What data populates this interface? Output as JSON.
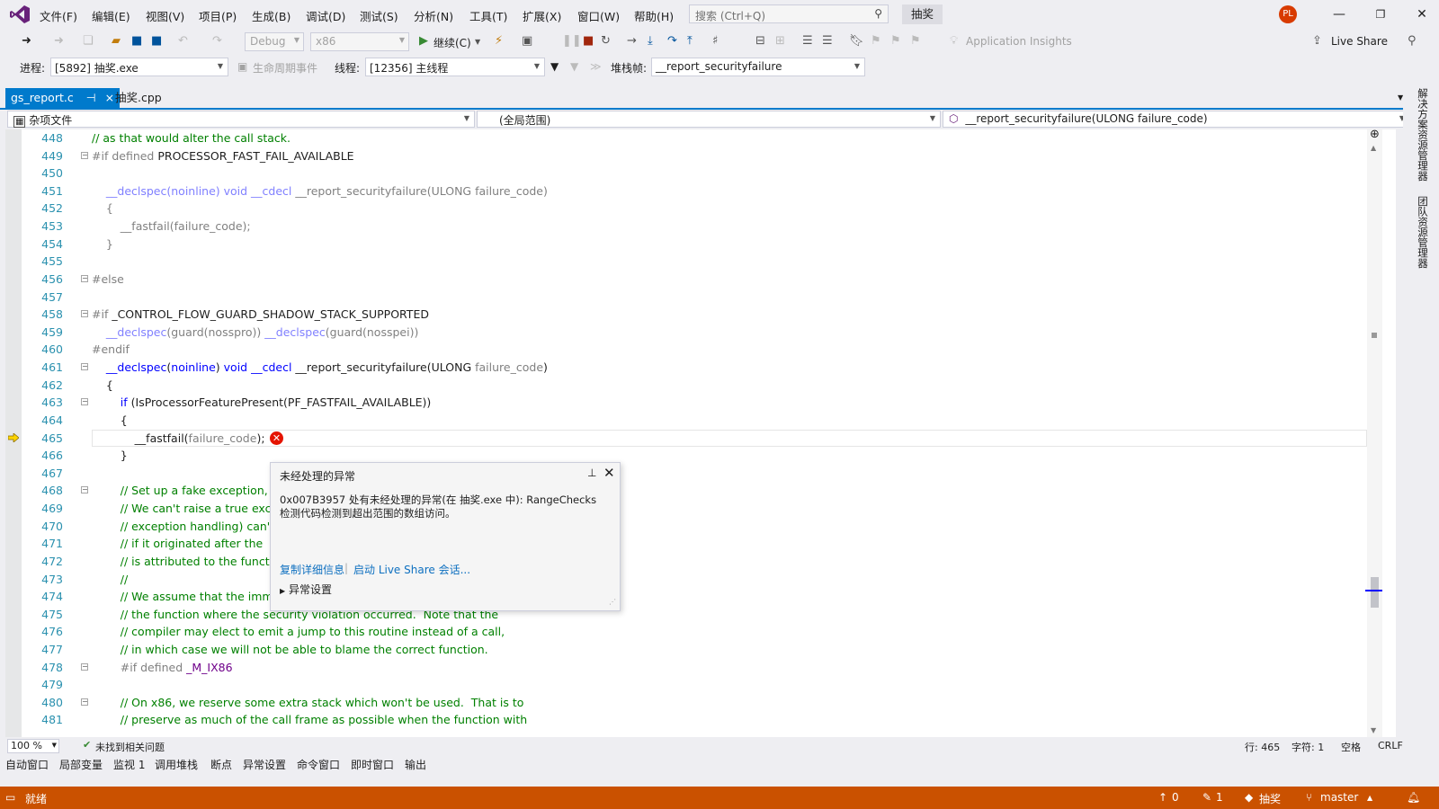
{
  "menu": {
    "items": [
      "文件(F)",
      "编辑(E)",
      "视图(V)",
      "项目(P)",
      "生成(B)",
      "调试(D)",
      "测试(S)",
      "分析(N)",
      "工具(T)",
      "扩展(X)",
      "窗口(W)",
      "帮助(H)"
    ],
    "search_placeholder": "搜索 (Ctrl+Q)",
    "project_name": "抽奖",
    "avatar_initials": "PL"
  },
  "toolbar": {
    "config": "Debug",
    "platform": "x86",
    "continue_label": "继续(C)",
    "app_insights": "Application Insights",
    "live_share": "Live Share"
  },
  "debug_location": {
    "process_label": "进程:",
    "process_value": "[5892] 抽奖.exe",
    "lifecycle_label": "生命周期事件",
    "thread_label": "线程:",
    "thread_value": "[12356] 主线程",
    "stackframe_label": "堆栈帧:",
    "stackframe_value": "__report_securityfailure"
  },
  "tabs": {
    "active": "gs_report.c",
    "pin": "⊣",
    "close": "×",
    "other": "抽奖.cpp"
  },
  "navbar": {
    "project": "杂项文件",
    "scope": "(全局范围)",
    "member": "__report_securityfailure(ULONG failure_code)"
  },
  "editor": {
    "current_line": 465,
    "lines": [
      {
        "n": "448",
        "fold": "",
        "segs": [
          {
            "t": "// as that would alter the call stack.",
            "c": "c-comment"
          }
        ]
      },
      {
        "n": "449",
        "fold": "−",
        "segs": [
          {
            "t": "#if defined ",
            "c": "c-gray"
          },
          {
            "t": "PROCESSOR_FAST_FAIL_AVAILABLE",
            "c": ""
          }
        ]
      },
      {
        "n": "450",
        "fold": "",
        "segs": []
      },
      {
        "n": "451",
        "fold": "",
        "segs": [
          {
            "t": "    __declspec(noinline) void __cdecl ",
            "c": "c-dim-kw"
          },
          {
            "t": "__report_securityfailure(ULONG failure_code)",
            "c": "c-dim"
          }
        ]
      },
      {
        "n": "452",
        "fold": "",
        "segs": [
          {
            "t": "    {",
            "c": "c-dim"
          }
        ]
      },
      {
        "n": "453",
        "fold": "",
        "segs": [
          {
            "t": "        __fastfail(failure_code);",
            "c": "c-dim"
          }
        ]
      },
      {
        "n": "454",
        "fold": "",
        "segs": [
          {
            "t": "    }",
            "c": "c-dim"
          }
        ]
      },
      {
        "n": "455",
        "fold": "",
        "segs": []
      },
      {
        "n": "456",
        "fold": "−",
        "segs": [
          {
            "t": "#else",
            "c": "c-gray"
          }
        ]
      },
      {
        "n": "457",
        "fold": "",
        "segs": []
      },
      {
        "n": "458",
        "fold": "−",
        "segs": [
          {
            "t": "#if ",
            "c": "c-gray"
          },
          {
            "t": "_CONTROL_FLOW_GUARD_SHADOW_STACK_SUPPORTED",
            "c": ""
          }
        ]
      },
      {
        "n": "459",
        "fold": "",
        "segs": [
          {
            "t": "    __declspec",
            "c": "c-dim-kw"
          },
          {
            "t": "(guard(nosspro)) ",
            "c": "c-dim"
          },
          {
            "t": "__declspec",
            "c": "c-dim-kw"
          },
          {
            "t": "(guard(nosspei))",
            "c": "c-dim"
          }
        ]
      },
      {
        "n": "460",
        "fold": "",
        "segs": [
          {
            "t": "#endif",
            "c": "c-gray"
          }
        ]
      },
      {
        "n": "461",
        "fold": "−",
        "segs": [
          {
            "t": "    __declspec",
            "c": "c-kw"
          },
          {
            "t": "(",
            "c": ""
          },
          {
            "t": "noinline",
            "c": "c-kw"
          },
          {
            "t": ") ",
            "c": ""
          },
          {
            "t": "void",
            "c": "c-kw"
          },
          {
            "t": " ",
            "c": ""
          },
          {
            "t": "__cdecl",
            "c": "c-kw"
          },
          {
            "t": " __report_securityfailure(ULONG ",
            "c": ""
          },
          {
            "t": "failure_code",
            "c": "c-gray"
          },
          {
            "t": ")",
            "c": ""
          }
        ]
      },
      {
        "n": "462",
        "fold": "",
        "segs": [
          {
            "t": "    {",
            "c": ""
          }
        ]
      },
      {
        "n": "463",
        "fold": "−",
        "segs": [
          {
            "t": "        ",
            "c": ""
          },
          {
            "t": "if",
            "c": "c-kw"
          },
          {
            "t": " (IsProcessorFeaturePresent(PF_FASTFAIL_AVAILABLE))",
            "c": ""
          }
        ]
      },
      {
        "n": "464",
        "fold": "",
        "segs": [
          {
            "t": "        {",
            "c": ""
          }
        ]
      },
      {
        "n": "465",
        "fold": "",
        "segs": [
          {
            "t": "            __fastfail(",
            "c": ""
          },
          {
            "t": "failure_code",
            "c": "c-gray"
          },
          {
            "t": ");",
            "c": ""
          }
        ]
      },
      {
        "n": "466",
        "fold": "",
        "segs": [
          {
            "t": "        }",
            "c": ""
          }
        ]
      },
      {
        "n": "467",
        "fold": "",
        "segs": []
      },
      {
        "n": "468",
        "fold": "−",
        "segs": [
          {
            "t": "        // Set up a fake exception,",
            "c": "c-comment"
          }
        ]
      },
      {
        "n": "469",
        "fold": "",
        "segs": [
          {
            "t": "        // We can't raise a true exc",
            "c": "c-comment"
          }
        ]
      },
      {
        "n": "470",
        "fold": "",
        "segs": [
          {
            "t": "        // exception handling) can'",
            "c": "c-comment"
          }
        ]
      },
      {
        "n": "471",
        "fold": "",
        "segs": [
          {
            "t": "        // if it originated after the ",
            "c": "c-comment"
          }
        ]
      },
      {
        "n": "472",
        "fold": "",
        "segs": [
          {
            "t": "        // is attributed to the funct",
            "c": "c-comment"
          }
        ]
      },
      {
        "n": "473",
        "fold": "",
        "segs": [
          {
            "t": "        //",
            "c": "c-comment"
          }
        ]
      },
      {
        "n": "474",
        "fold": "",
        "segs": [
          {
            "t": "        // We assume that the imm",
            "c": "c-comment"
          }
        ]
      },
      {
        "n": "475",
        "fold": "",
        "segs": [
          {
            "t": "        // the function where the security violation occurred.  Note that the",
            "c": "c-comment"
          }
        ]
      },
      {
        "n": "476",
        "fold": "",
        "segs": [
          {
            "t": "        // compiler may elect to emit a jump to this routine instead of a call,",
            "c": "c-comment"
          }
        ]
      },
      {
        "n": "477",
        "fold": "",
        "segs": [
          {
            "t": "        // in which case we will not be able to blame the correct function.",
            "c": "c-comment"
          }
        ]
      },
      {
        "n": "478",
        "fold": "−",
        "segs": [
          {
            "t": "        #if defined ",
            "c": "c-gray"
          },
          {
            "t": "_M_IX86",
            "c": "c-mac"
          }
        ]
      },
      {
        "n": "479",
        "fold": "",
        "segs": []
      },
      {
        "n": "480",
        "fold": "−",
        "segs": [
          {
            "t": "        // On x86, we reserve some extra stack which won't be used.  That is to",
            "c": "c-comment"
          }
        ]
      },
      {
        "n": "481",
        "fold": "",
        "segs": [
          {
            "t": "        // preserve as much of the call frame as possible when the function with",
            "c": "c-comment"
          }
        ]
      }
    ]
  },
  "exception_popup": {
    "title": "未经处理的异常",
    "message": "0x007B3957 处有未经处理的异常(在 抽奖.exe 中): RangeChecks 检测代码检测到超出范围的数组访问。",
    "copy_details": "复制详细信息",
    "start_live_share": "启动 Live Share 会话...",
    "exception_settings": "异常设置"
  },
  "editor_status": {
    "zoom": "100 %",
    "issues": "未找到相关问题",
    "line": "行: 465",
    "char": "字符: 1",
    "spaces": "空格",
    "eol": "CRLF"
  },
  "bottom_tabs": [
    "自动窗口",
    "局部变量",
    "监视 1",
    "调用堆栈",
    "断点",
    "异常设置",
    "命令窗口",
    "即时窗口",
    "输出"
  ],
  "right_panel": {
    "solution_explorer": "解决方案资源管理器",
    "team_explorer": "团队资源管理器"
  },
  "statusbar": {
    "state": "就绪",
    "up_count": "0",
    "pencil_count": "1",
    "repo": "抽奖",
    "branch": "master"
  },
  "colors": {
    "accent": "#007acc",
    "statusbar": "#ca5100",
    "error": "#e51400"
  }
}
